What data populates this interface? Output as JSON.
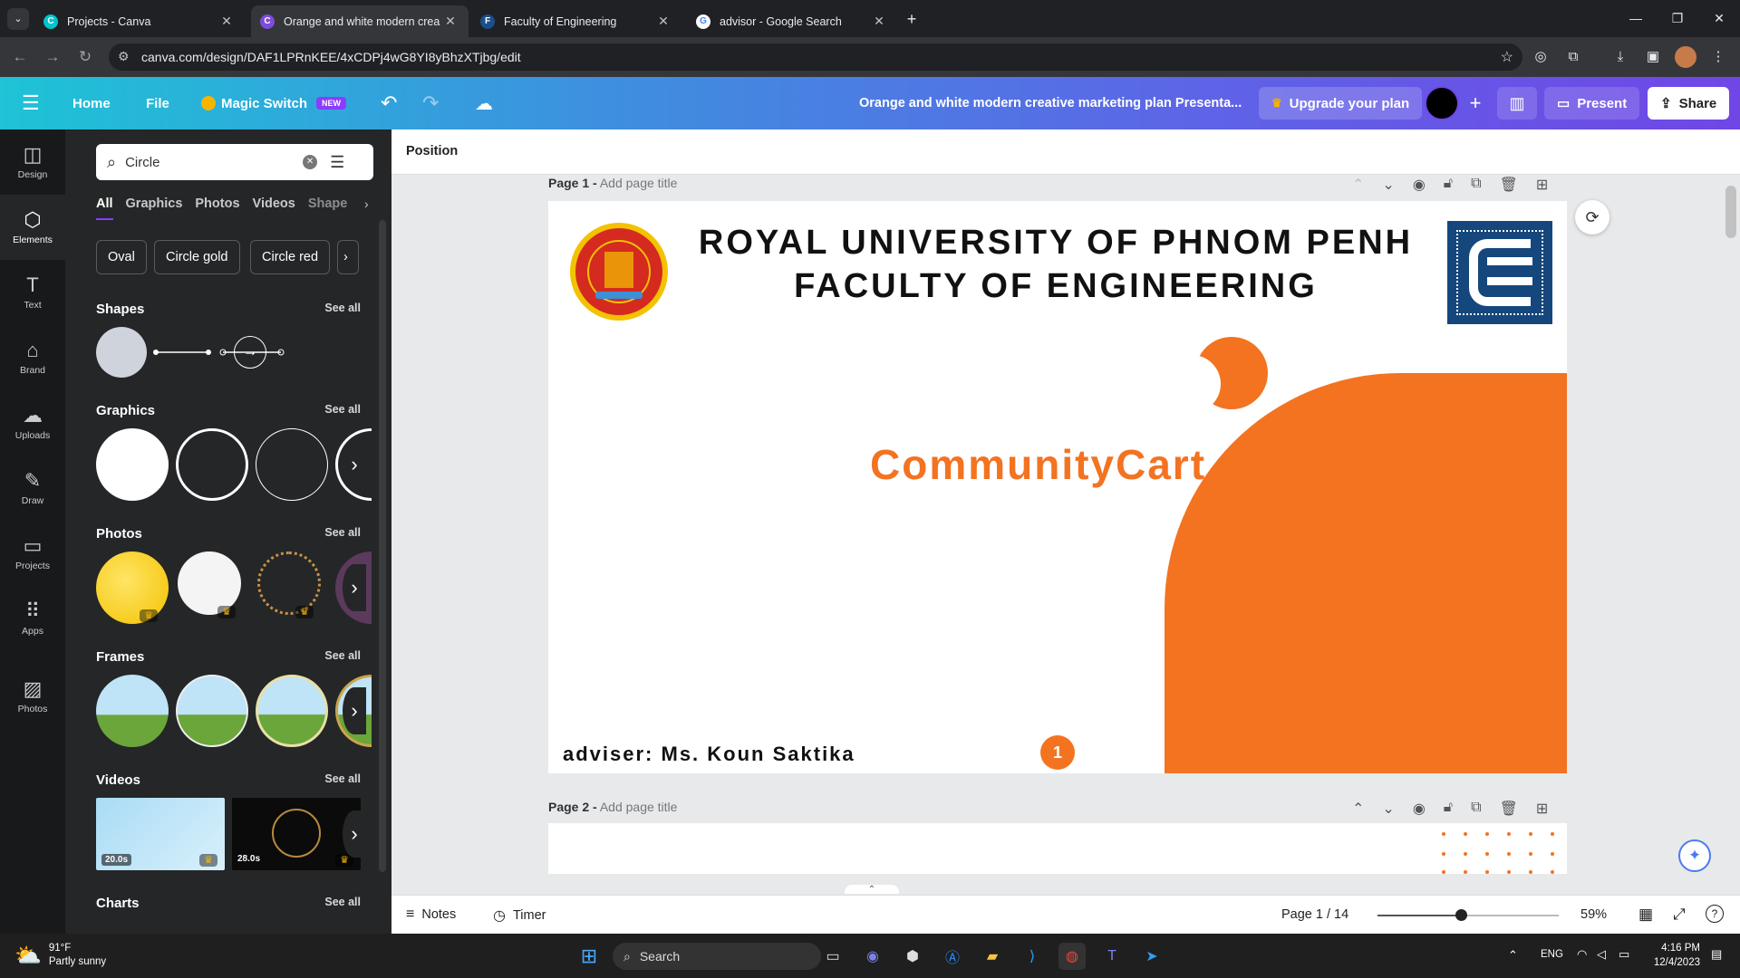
{
  "browser": {
    "tabs": [
      {
        "title": "Projects - Canva",
        "active": false
      },
      {
        "title": "Orange and white modern crea",
        "active": true
      },
      {
        "title": "Faculty of Engineering",
        "active": false
      },
      {
        "title": "advisor - Google Search",
        "active": false
      }
    ],
    "url": "canva.com/design/DAF1LPRnKEE/4xCDPj4wG8YI8yBhzXTjbg/edit"
  },
  "header": {
    "home": "Home",
    "file": "File",
    "magic_switch": "Magic Switch",
    "new_badge": "NEW",
    "doc_title": "Orange and white modern creative marketing plan Presenta...",
    "upgrade": "Upgrade your plan",
    "present": "Present",
    "share": "Share"
  },
  "rail": [
    {
      "label": "Design",
      "icon": "layout-icon"
    },
    {
      "label": "Elements",
      "icon": "shapes-icon",
      "selected": true
    },
    {
      "label": "Text",
      "icon": "text-icon"
    },
    {
      "label": "Brand",
      "icon": "brand-icon"
    },
    {
      "label": "Uploads",
      "icon": "upload-icon"
    },
    {
      "label": "Draw",
      "icon": "pen-icon"
    },
    {
      "label": "Projects",
      "icon": "folder-icon"
    },
    {
      "label": "Apps",
      "icon": "grid-icon"
    },
    {
      "label": "Photos",
      "icon": "image-icon"
    }
  ],
  "panel": {
    "search_value": "Circle",
    "tabs": [
      "All",
      "Graphics",
      "Photos",
      "Videos",
      "Shape"
    ],
    "chips": [
      "Oval",
      "Circle gold",
      "Circle red"
    ],
    "sections": {
      "shapes": "Shapes",
      "graphics": "Graphics",
      "photos": "Photos",
      "frames": "Frames",
      "videos": "Videos",
      "charts": "Charts"
    },
    "see_all": "See all",
    "video_durations": [
      "20.0s",
      "28.0s"
    ]
  },
  "canvas": {
    "toolbar_label": "Position",
    "page1_label": "Page 1 -",
    "page2_label": "Page 2 -",
    "add_title": "Add page title",
    "slide": {
      "title_line1": "ROYAL UNIVERSITY OF PHNOM PENH",
      "title_line2": "FACULTY OF ENGINEERING",
      "project": "CommunityCart",
      "adviser": "adviser: Ms. Koun Saktika",
      "page_badge": "1",
      "accent": "#f37321"
    }
  },
  "footer": {
    "notes": "Notes",
    "timer": "Timer",
    "page_indicator": "Page 1 / 14",
    "zoom": "59%"
  },
  "taskbar": {
    "weather_temp": "91°F",
    "weather_desc": "Partly sunny",
    "search": "Search",
    "lang": "ENG",
    "time": "4:16 PM",
    "date": "12/4/2023"
  }
}
